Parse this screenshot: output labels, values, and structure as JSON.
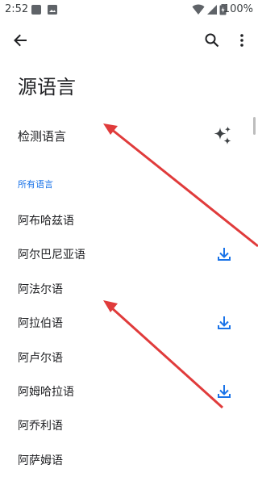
{
  "status_bar": {
    "time": "2:52",
    "battery": "100%",
    "icons": [
      "notification-icon",
      "image-icon",
      "wifi-icon",
      "signal-icon",
      "battery-charging-icon"
    ]
  },
  "app_bar": {
    "back_icon": "arrow-back-icon",
    "search_icon": "search-icon",
    "more_icon": "more-vert-icon"
  },
  "page": {
    "title": "源语言"
  },
  "detect": {
    "label": "检测语言",
    "icon": "sparkle-icon"
  },
  "section": {
    "all_languages": "所有语言"
  },
  "languages": [
    {
      "label": "阿布哈兹语",
      "downloadable": false
    },
    {
      "label": "阿尔巴尼亚语",
      "downloadable": true
    },
    {
      "label": "阿法尔语",
      "downloadable": false
    },
    {
      "label": "阿拉伯语",
      "downloadable": true
    },
    {
      "label": "阿卢尔语",
      "downloadable": false
    },
    {
      "label": "阿姆哈拉语",
      "downloadable": true
    },
    {
      "label": "阿乔利语",
      "downloadable": false
    },
    {
      "label": "阿萨姆语",
      "downloadable": false
    }
  ],
  "colors": {
    "accent": "#1a73e8",
    "annotation_arrow": "#e03b3b",
    "text": "#202124"
  }
}
